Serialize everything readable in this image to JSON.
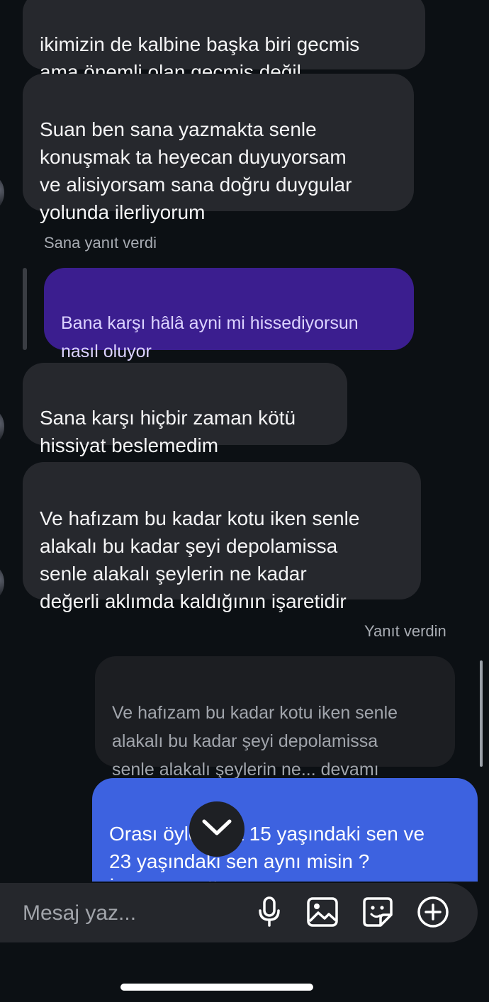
{
  "messages": {
    "m1": "ikimizin de kalbine başka biri gecmis\nama önemli olan geçmiş değil",
    "m2": "Suan ben sana yazmakta senle\nkonuşmak ta heyecan duyuyorsam\nve alisiyorsam sana doğru duygular\nyolunda ilerliyorum",
    "reply_label_them": "Sana yanıt verdi",
    "quoted_purple": "Bana karşı hâlâ ayni mi hissediyorsun\nnasıl oluyor",
    "m3": "Sana karşı hiçbir zaman kötü\nhissiyat beslemedim",
    "m4": "Ve hafızam bu kadar kotu iken senle\nalakalı bu kadar şeyi depolamissa\nsenle alakalı şeylerin ne kadar\ndeğerli aklımda kaldığının işaretidir",
    "reply_label_me": "Yanıt verdin",
    "quoted_grey": "Ve hafızam bu kadar kotu iken senle\nalakalı bu kadar şeyi depolamissa\nsenle alakalı şeylerin ne... devamı",
    "out1": "Orası öyle ama 15 yaşındaki sen ve\n23 yaşındaki sen aynı misin ?\nİnsanlar değişiyor duygular\ndeğişiyor"
  },
  "composer": {
    "placeholder": "Mesaj yaz..."
  },
  "icons": {
    "scroll_down": "chevron-down-icon",
    "mic": "microphone-icon",
    "gallery": "image-icon",
    "sticker": "sticker-icon",
    "add": "plus-circle-icon"
  },
  "colors": {
    "background": "#0c1014",
    "incoming": "#26282d",
    "outgoing": "#3d62e0",
    "quoted_purple": "#3b1e8f"
  }
}
